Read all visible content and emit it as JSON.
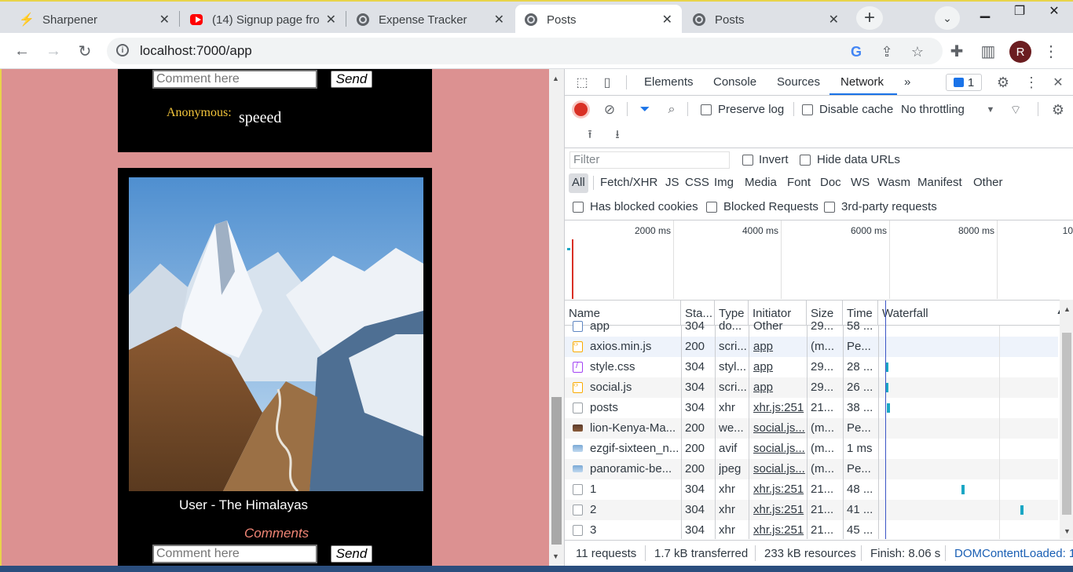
{
  "tabs": [
    {
      "title": "Sharpener",
      "icon": "sharpener-bolt-icon"
    },
    {
      "title": "(14) Signup page fro",
      "icon": "youtube-icon"
    },
    {
      "title": "Expense Tracker",
      "icon": "globe-icon"
    },
    {
      "title": "Posts",
      "icon": "globe-icon",
      "active": true
    },
    {
      "title": "Posts",
      "icon": "globe-icon"
    }
  ],
  "address": {
    "url": "localhost:7000/app",
    "profile_initial": "R"
  },
  "page": {
    "post1": {
      "comment_placeholder": "Comment here",
      "send_label": "Send",
      "comment_author": "Anonymous:",
      "comment_text": "speeed"
    },
    "post2": {
      "caption": "User - The Himalayas",
      "comments_label": "Comments",
      "comment_placeholder": "Comment here",
      "send_label": "Send"
    }
  },
  "devtools": {
    "tabs": [
      "Elements",
      "Console",
      "Sources",
      "Network"
    ],
    "active_tab": "Network",
    "more_tabs": "»",
    "issues_count": "1",
    "toolbar": {
      "preserve_log": "Preserve log",
      "disable_cache": "Disable cache",
      "throttling": "No throttling"
    },
    "filter": {
      "placeholder": "Filter",
      "invert": "Invert",
      "hide_data_urls": "Hide data URLs"
    },
    "types": [
      "All",
      "Fetch/XHR",
      "JS",
      "CSS",
      "Img",
      "Media",
      "Font",
      "Doc",
      "WS",
      "Wasm",
      "Manifest",
      "Other"
    ],
    "checks": {
      "blocked_cookies": "Has blocked cookies",
      "blocked_requests": "Blocked Requests",
      "third_party": "3rd-party requests"
    },
    "overview_ticks": [
      "2000 ms",
      "4000 ms",
      "6000 ms",
      "8000 ms",
      "10"
    ],
    "columns": [
      "Name",
      "Sta...",
      "Type",
      "Initiator",
      "Size",
      "Time",
      "Waterfall"
    ],
    "rows": [
      {
        "name": "app",
        "status": "304",
        "type": "do...",
        "initiator": "Other",
        "size": "29...",
        "time": "58 ...",
        "icon": "doc",
        "init_link": false
      },
      {
        "name": "axios.min.js",
        "status": "200",
        "type": "scri...",
        "initiator": "app",
        "size": "(m...",
        "time": "Pe...",
        "icon": "js",
        "init_link": true
      },
      {
        "name": "style.css",
        "status": "304",
        "type": "styl...",
        "initiator": "app",
        "size": "29...",
        "time": "28 ...",
        "icon": "css",
        "init_link": true
      },
      {
        "name": "social.js",
        "status": "304",
        "type": "scri...",
        "initiator": "app",
        "size": "29...",
        "time": "26 ...",
        "icon": "js",
        "init_link": true
      },
      {
        "name": "posts",
        "status": "304",
        "type": "xhr",
        "initiator": "xhr.js:251",
        "size": "21...",
        "time": "38 ...",
        "icon": "blank",
        "init_link": true
      },
      {
        "name": "lion-Kenya-Ma...",
        "status": "200",
        "type": "we...",
        "initiator": "social.js...",
        "size": "(m...",
        "time": "Pe...",
        "icon": "img",
        "init_link": true
      },
      {
        "name": "ezgif-sixteen_n...",
        "status": "200",
        "type": "avif",
        "initiator": "social.js...",
        "size": "(m...",
        "time": "1 ms",
        "icon": "img2",
        "init_link": true
      },
      {
        "name": "panoramic-be...",
        "status": "200",
        "type": "jpeg",
        "initiator": "social.js...",
        "size": "(m...",
        "time": "Pe...",
        "icon": "img2",
        "init_link": true
      },
      {
        "name": "1",
        "status": "304",
        "type": "xhr",
        "initiator": "xhr.js:251",
        "size": "21...",
        "time": "48 ...",
        "icon": "blank",
        "init_link": true
      },
      {
        "name": "2",
        "status": "304",
        "type": "xhr",
        "initiator": "xhr.js:251",
        "size": "21...",
        "time": "41 ...",
        "icon": "blank",
        "init_link": true
      },
      {
        "name": "3",
        "status": "304",
        "type": "xhr",
        "initiator": "xhr.js:251",
        "size": "21...",
        "time": "45 ...",
        "icon": "blank",
        "init_link": true
      }
    ],
    "status": {
      "requests": "11 requests",
      "transferred": "1.7 kB transferred",
      "resources": "233 kB resources",
      "finish": "Finish: 8.06 s",
      "dcl": "DOMContentLoaded: 1"
    }
  }
}
